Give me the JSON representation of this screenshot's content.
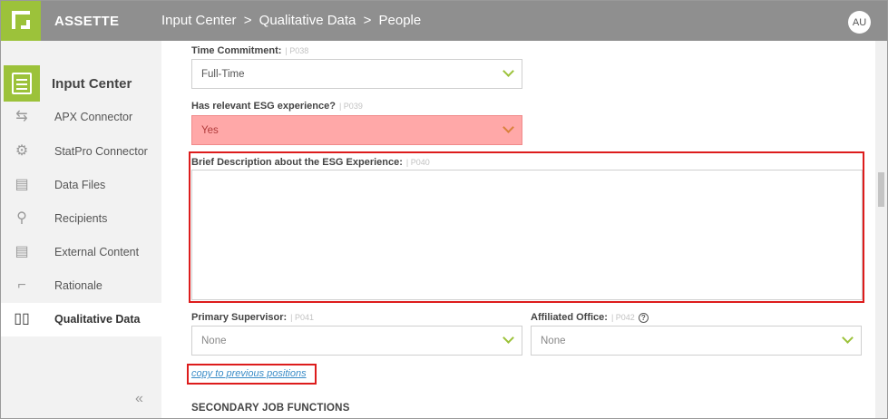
{
  "app": {
    "brand": "ASSETTE",
    "avatar_initials": "AU"
  },
  "breadcrumb": [
    "Input Center",
    ">",
    "Qualitative Data",
    ">",
    "People"
  ],
  "sidebar": {
    "title": "Input Center",
    "items": [
      {
        "label": "APX Connector",
        "icon": "apx-connector-icon"
      },
      {
        "label": "StatPro Connector",
        "icon": "statpro-connector-icon"
      },
      {
        "label": "Data Files",
        "icon": "data-files-icon"
      },
      {
        "label": "Recipients",
        "icon": "recipients-icon"
      },
      {
        "label": "External Content",
        "icon": "external-content-icon"
      },
      {
        "label": "Rationale",
        "icon": "rationale-icon"
      },
      {
        "label": "Qualitative Data",
        "icon": "book-icon",
        "active": true
      }
    ],
    "collapse_glyph": "«"
  },
  "form": {
    "time_commitment": {
      "label": "Time Commitment:",
      "code": "| P038",
      "value": "Full-Time"
    },
    "esg_experience": {
      "label": "Has relevant ESG experience?",
      "code": "| P039",
      "value": "Yes"
    },
    "esg_description": {
      "label": "Brief Description about the ESG Experience:",
      "code": "| P040",
      "value": ""
    },
    "primary_supervisor": {
      "label": "Primary Supervisor:",
      "code": "| P041",
      "value": "None"
    },
    "affiliated_office": {
      "label": "Affiliated Office:",
      "code": "| P042",
      "value": "None"
    },
    "copy_link": "copy to previous positions",
    "section_title": "SECONDARY JOB FUNCTIONS"
  },
  "colors": {
    "accent": "#9cc23a",
    "topbar": "#8f8f8f",
    "error_bg": "#ffa8a8",
    "highlight": "#dd1c1c",
    "link": "#3a8cc7"
  }
}
